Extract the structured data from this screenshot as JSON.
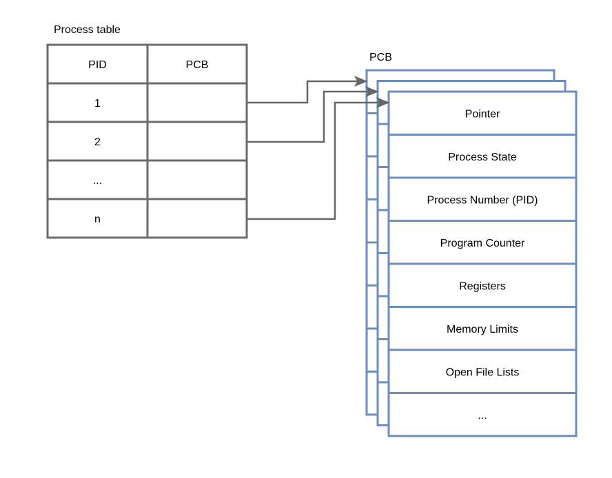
{
  "process_table": {
    "title": "Process table",
    "headers": [
      "PID",
      "PCB"
    ],
    "rows": [
      {
        "pid": "1",
        "pcb": ""
      },
      {
        "pid": "2",
        "pcb": ""
      },
      {
        "pid": "...",
        "pcb": ""
      },
      {
        "pid": "n",
        "pcb": ""
      }
    ]
  },
  "pcb": {
    "title": "PCB",
    "stack_count": 3,
    "fields": [
      "Pointer",
      "Process State",
      "Process Number (PID)",
      "Program Counter",
      "Registers",
      "Memory Limits",
      "Open File Lists",
      "..."
    ]
  },
  "arrows": [
    {
      "from_row": "1",
      "to_pcb": 1
    },
    {
      "from_row": "2",
      "to_pcb": 2
    },
    {
      "from_row": "n",
      "to_pcb": 3
    }
  ],
  "colors": {
    "table_stroke": "#6b6b6b",
    "pcb_stroke": "#6c8ebf",
    "arrow": "#666666"
  }
}
